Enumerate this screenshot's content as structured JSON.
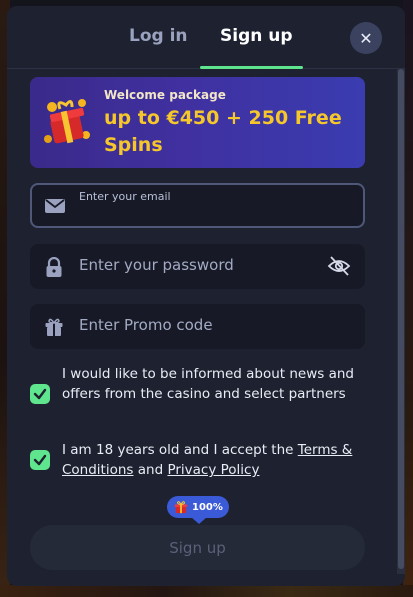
{
  "tabs": {
    "login_label": "Log in",
    "signup_label": "Sign up",
    "active": "signup"
  },
  "banner": {
    "kicker": "Welcome package",
    "title": "up to €450 + 250 Free Spins"
  },
  "email": {
    "label": "Enter your email",
    "value": ""
  },
  "password": {
    "placeholder": "Enter your password"
  },
  "promo": {
    "placeholder": "Enter Promo code"
  },
  "consents": {
    "news": {
      "checked": true,
      "text": "I would like to be informed about news and offers from the casino and select partners"
    },
    "age": {
      "checked": true,
      "text_before": "I am 18 years old and I accept the ",
      "terms_link": "Terms & Conditions",
      "text_mid": " and ",
      "privacy_link": "Privacy Policy"
    }
  },
  "progress_badge": {
    "label": "100%",
    "value": 1.0
  },
  "submit": {
    "label": "Sign up",
    "enabled": false
  },
  "colors": {
    "accent": "#5ee58d",
    "modal_bg": "#1e2230",
    "banner_text": "#f5c72a",
    "badge": "#3b5ad8"
  },
  "icons": [
    "close-icon",
    "gift-icon",
    "mail-icon",
    "lock-icon",
    "eye-off-icon",
    "check-icon"
  ]
}
